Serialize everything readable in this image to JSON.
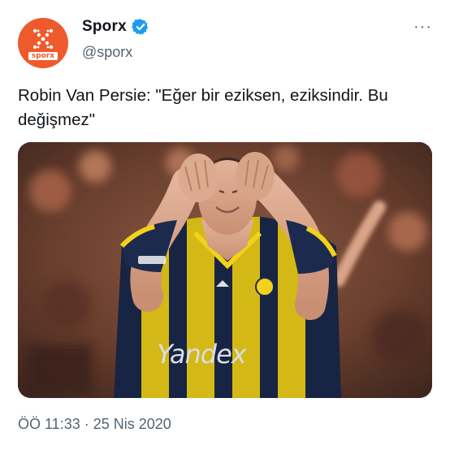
{
  "account": {
    "display_name": "Sporx",
    "handle": "@sporx",
    "logo_text": "sporx",
    "verified_icon": "verified-badge-icon",
    "brand_color": "#ee5a2c",
    "verified_color": "#1d9bf0"
  },
  "more_icon": "more-options-icon",
  "tweet": {
    "text": "Robin Van Persie: \"Eğer bir eziksen, eziksindir. Bu değişmez\"",
    "timestamp": "ÖÖ 11:33 · 25 Nis 2020"
  },
  "media": {
    "jersey_sponsor": "Yandex",
    "colors": {
      "jersey_navy": "#1c2a4e",
      "jersey_yellow": "#f2d21a",
      "background_crowd": "#6b3f2e"
    }
  }
}
